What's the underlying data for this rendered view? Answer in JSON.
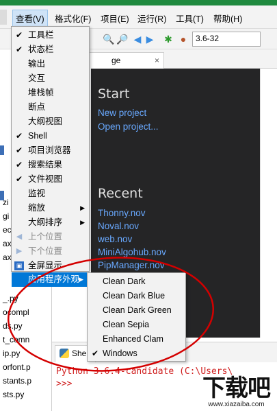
{
  "menubar": {
    "items": [
      {
        "label": "查看(V)"
      },
      {
        "label": "格式化(F)"
      },
      {
        "label": "项目(E)"
      },
      {
        "label": "运行(R)"
      },
      {
        "label": "工具(T)"
      },
      {
        "label": "帮助(H)"
      }
    ]
  },
  "toolbar": {
    "version_value": "3.6-32"
  },
  "editor": {
    "tab_partial": "ge",
    "tab_close": "×"
  },
  "welcome": {
    "start_heading": "Start",
    "start_links": [
      "New project",
      "Open project..."
    ],
    "recent_heading": "Recent",
    "recent_links": [
      "Thonny.nov",
      "Noval.nov",
      "web.nov",
      "MiniAlgohub.nov",
      "PipManager.nov"
    ]
  },
  "file_list": [
    "zi",
    "gi",
    "ec",
    "ax",
    "ax",
    "_.py",
    "ocompl",
    "ds.py",
    "t_comn",
    "ip.py",
    "orfont.p",
    "stants.p",
    "sts.py"
  ],
  "view_menu": {
    "items": [
      {
        "label": "工具栏",
        "checked": true
      },
      {
        "label": "状态栏",
        "checked": true
      },
      {
        "label": "输出",
        "checked": false
      },
      {
        "label": "交互",
        "checked": false
      },
      {
        "label": "堆栈帧",
        "checked": false
      },
      {
        "label": "断点",
        "checked": false
      },
      {
        "label": "大纲视图",
        "checked": false
      },
      {
        "label": "Shell",
        "checked": true
      },
      {
        "label": "项目浏览器",
        "checked": true
      },
      {
        "label": "搜索结果",
        "checked": true
      },
      {
        "label": "文件视图",
        "checked": true
      },
      {
        "label": "监视",
        "checked": false
      },
      {
        "label": "缩放",
        "checked": false,
        "submenu": true
      },
      {
        "label": "大纲排序",
        "checked": false,
        "submenu": true
      },
      {
        "label": "上个位置",
        "disabled": true
      },
      {
        "label": "下个位置",
        "disabled": true
      },
      {
        "label": "全屏显示"
      },
      {
        "label": "应用程序外观",
        "submenu": true,
        "highlighted": true
      }
    ]
  },
  "appearance_submenu": {
    "items": [
      {
        "label": "Clean Dark",
        "checked": false
      },
      {
        "label": "Clean Dark Blue",
        "checked": false
      },
      {
        "label": "Clean Dark Green",
        "checked": false
      },
      {
        "label": "Clean Sepia",
        "checked": false
      },
      {
        "label": "Enhanced Clam",
        "checked": false
      },
      {
        "label": "Windows",
        "checked": true
      }
    ]
  },
  "shell": {
    "tab_label": "Shel",
    "banner": "Python 3.6.4-candidate (C:\\Users\\",
    "prompt": ">>>"
  },
  "watermark": {
    "big": "下载吧",
    "small": "www.xiazaiba.com"
  },
  "colors": {
    "accent": "#0078d7",
    "annotation": "#d40000",
    "link": "#69a9ff",
    "welcome_bg": "#252526"
  }
}
